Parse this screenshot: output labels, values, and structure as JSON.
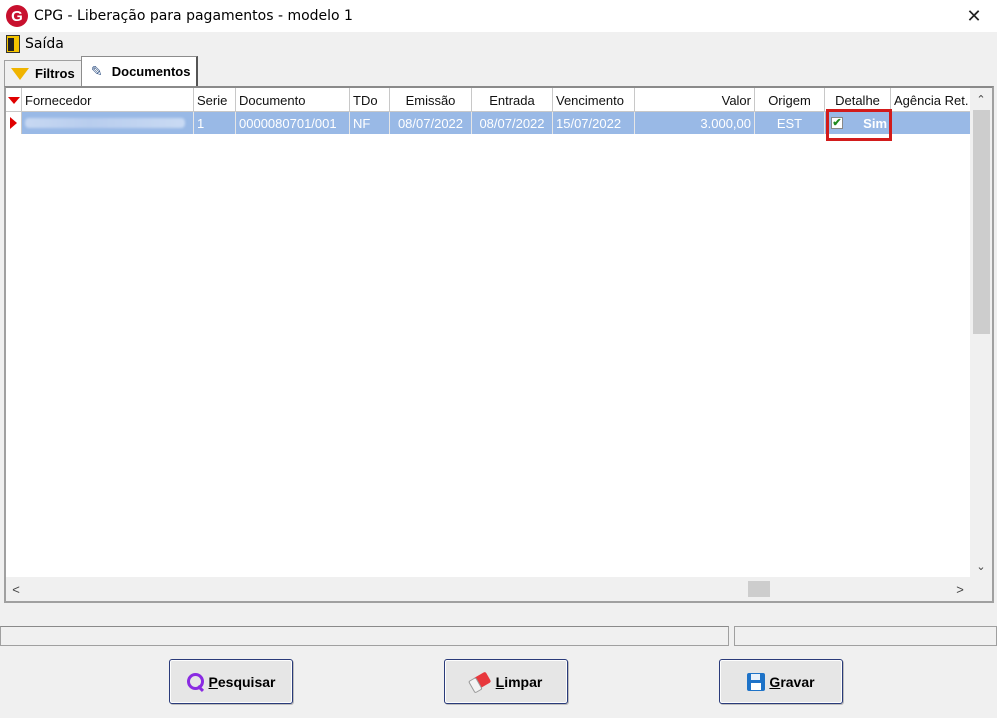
{
  "window": {
    "title": "CPG - Liberação para pagamentos - modelo 1",
    "logo_letter": "G",
    "close_glyph": "✕"
  },
  "menu": {
    "items": [
      {
        "label": "Saída",
        "icon": "exit-door-icon"
      }
    ]
  },
  "tabs": [
    {
      "label": "Filtros",
      "icon": "filter-icon",
      "active": false
    },
    {
      "label": "Documentos",
      "icon": "document-pencil-icon",
      "active": true
    }
  ],
  "grid": {
    "columns": [
      "Fornecedor",
      "Serie",
      "Documento",
      "TDo",
      "Emissão",
      "Entrada",
      "Vencimento",
      "Valor",
      "Origem",
      "Detalhe",
      "Agência Ret."
    ],
    "rows": [
      {
        "fornecedor": "",
        "fornecedor_blurred": true,
        "serie": "1",
        "documento": "0000080701/001",
        "tdo": "NF",
        "emissao": "08/07/2022",
        "entrada": "08/07/2022",
        "vencimento": "15/07/2022",
        "valor": "3.000,00",
        "origem": "EST",
        "detalhe_checked": true,
        "detalhe": "Sim",
        "agencia_ret": ""
      }
    ],
    "selected_row_color": "#99b9e6",
    "highlight_color": "#d21b1b"
  },
  "scroll": {
    "up": "⌃",
    "down": "⌄",
    "left": "<",
    "right": ">"
  },
  "buttons": {
    "search": {
      "label": "Pesquisar",
      "icon": "search-icon"
    },
    "clear": {
      "label": "Limpar",
      "icon": "eraser-icon"
    },
    "save": {
      "label": "Gravar",
      "icon": "save-icon"
    }
  }
}
